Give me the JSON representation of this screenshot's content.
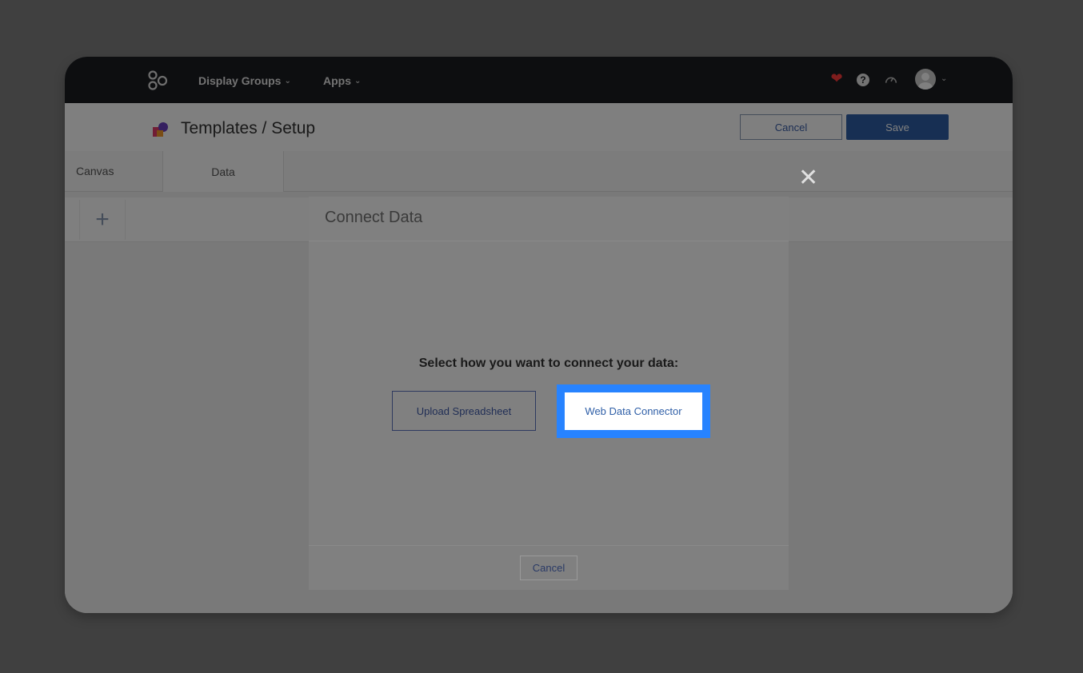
{
  "nav": {
    "display_groups": "Display Groups",
    "apps": "Apps"
  },
  "header": {
    "page_title": "Templates / Setup",
    "cancel_label": "Cancel",
    "save_label": "Save"
  },
  "tabs": [
    {
      "label": "Canvas"
    },
    {
      "label": "Data"
    }
  ],
  "toolbar": {
    "add_symbol": "+"
  },
  "modal": {
    "title": "Connect Data",
    "prompt": "Select how you want to connect your data:",
    "upload_label": "Upload Spreadsheet",
    "wdc_label": "Web Data Connector",
    "cancel_label": "Cancel"
  },
  "icons": {
    "close": "✕",
    "heart": "❤",
    "help": "?",
    "chevron": "⌄"
  },
  "colors": {
    "primary": "#2f5fa7",
    "highlight": "#2783ff",
    "topbar": "#1b1c20",
    "heart": "#ff3b3b"
  }
}
